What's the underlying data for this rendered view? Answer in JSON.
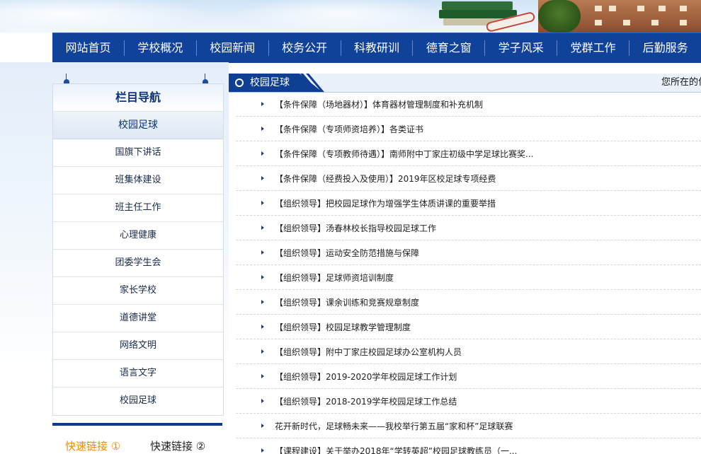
{
  "nav": {
    "items": [
      "网站首页",
      "学校概况",
      "校园新闻",
      "校务公开",
      "科教研训",
      "德育之窗",
      "学子风采",
      "党群工作",
      "后勤服务"
    ]
  },
  "sidebar": {
    "title": "栏目导航",
    "current": "校园足球",
    "items": [
      "国旗下讲话",
      "班集体建设",
      "班主任工作",
      "心理健康",
      "团委学生会",
      "家长学校",
      "道德讲堂",
      "网络文明",
      "语言文字",
      "校园足球"
    ]
  },
  "quick_links": {
    "tab1": "快速链接 ①",
    "tab2": "快速链接 ②"
  },
  "content": {
    "section_title": "校园足球",
    "location_label": "您所在的位",
    "articles": [
      "【条件保障（场地器材）】体育器材管理制度和补充机制",
      "【条件保障（专项师资培养）】各类证书",
      "【条件保障（专项教师待遇）】南师附中丁家庄初级中学足球比赛奖...",
      "【条件保障（经费投入及使用）】2019年区校足球专项经费",
      "【组织领导】把校园足球作为增强学生体质讲课的重要举措",
      "【组织领导】汤春林校长指导校园足球工作",
      "【组织领导】运动安全防范措施与保障",
      "【组织领导】足球师资培训制度",
      "【组织领导】课余训练和竞赛规章制度",
      "【组织领导】校园足球教学管理制度",
      "【组织领导】附中丁家庄校园足球办公室机构人员",
      "【组织领导】2019-2020学年校园足球工作计划",
      "【组织领导】2018-2019学年校园足球工作总结",
      "花开新时代，足球畅未来——我校举行第五届“家和杯”足球联赛",
      "【课程建设】关于举办2018年“学转英超”校园足球教练员（一..."
    ]
  },
  "colors": {
    "nav_bg": "#10429a",
    "accent": "#f08c00",
    "heading": "#0b3578"
  }
}
